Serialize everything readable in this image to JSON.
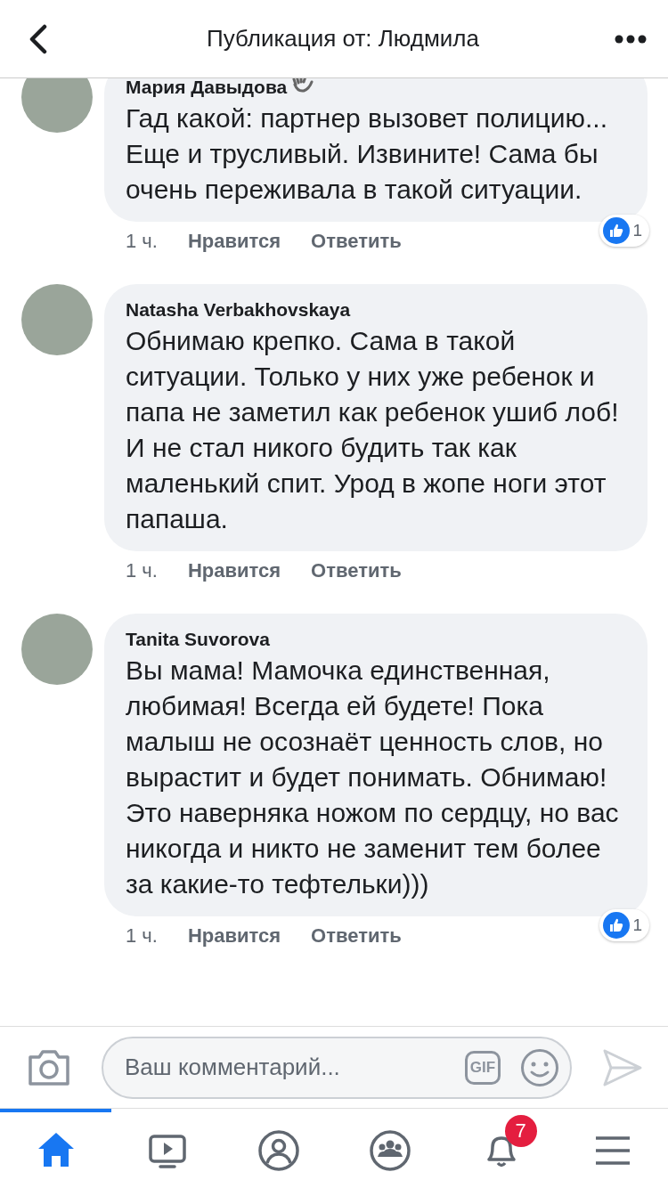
{
  "header": {
    "title": "Публикация от: Людмила"
  },
  "comments": [
    {
      "author": "Мария Давыдова",
      "badge": true,
      "text": "Гад какой: партнер вызовет полицию... Еще и трусливый. Извините! Сама бы очень переживала в такой ситуации.",
      "time": "1 ч.",
      "like_label": "Нравится",
      "reply_label": "Ответить",
      "reaction_count": "1"
    },
    {
      "author": "Natasha Verbakhovskaya",
      "badge": false,
      "text": "Обнимаю крепко. Сама в такой ситуации. Только у них уже ребенок и папа не заметил как ребенок ушиб лоб! И не стал никого будить так как маленький спит. Урод в жопе ноги этот папаша.",
      "time": "1 ч.",
      "like_label": "Нравится",
      "reply_label": "Ответить"
    },
    {
      "author": "Tanita Suvorova",
      "badge": false,
      "text": "Вы мама! Мамочка единственная, любимая! Всегда ей будете! Пока малыш не осознаёт ценность слов, но вырастит и будет понимать. Обнимаю! Это наверняка ножом по сердцу, но вас никогда и никто не заменит тем более за какие-то тефтельки)))",
      "time": "1 ч.",
      "like_label": "Нравится",
      "reply_label": "Ответить",
      "reaction_count": "1"
    }
  ],
  "composer": {
    "placeholder": "Ваш комментарий...",
    "gif_label": "GIF"
  },
  "tabbar": {
    "items": [
      {
        "kind": "home",
        "selected": true
      },
      {
        "kind": "video",
        "selected": false
      },
      {
        "kind": "profile",
        "selected": false
      },
      {
        "kind": "groups",
        "selected": false
      },
      {
        "kind": "notifications",
        "selected": false,
        "badge": "7"
      },
      {
        "kind": "menu",
        "selected": false
      }
    ]
  }
}
